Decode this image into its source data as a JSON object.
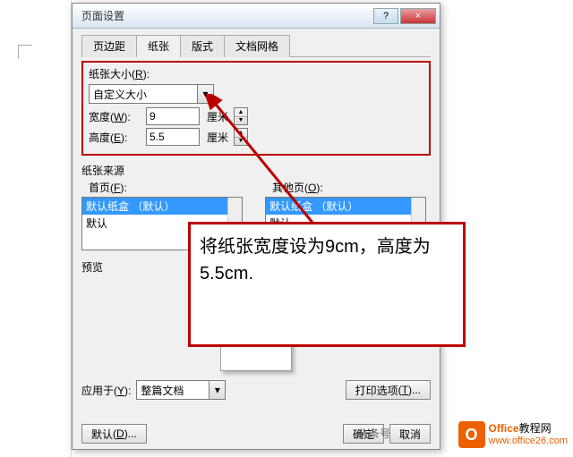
{
  "dialog": {
    "title": "页面设置",
    "help_btn": "?",
    "close_btn": "×"
  },
  "tabs": {
    "margins": "页边距",
    "paper": "纸张",
    "layout": "版式",
    "grid": "文档网格"
  },
  "paper_size": {
    "group_label": "纸张大小",
    "group_key": "R",
    "selected": "自定义大小",
    "width_label": "宽度",
    "width_key": "W",
    "width_value": "9",
    "width_unit": "厘米",
    "height_label": "高度",
    "height_key": "E",
    "height_value": "5.5",
    "height_unit": "厘米"
  },
  "paper_source": {
    "section": "纸张来源",
    "first_page_label": "首页",
    "first_key": "F",
    "other_page_label": "其他页",
    "other_key": "O",
    "items": {
      "default_tray": "默认纸盒 （默认）",
      "default": "默认"
    }
  },
  "preview": {
    "label": "预览"
  },
  "apply": {
    "label": "应用于",
    "key": "Y",
    "value": "整篇文档"
  },
  "buttons": {
    "print_options": "打印选项",
    "print_key": "T",
    "default": "默认",
    "default_key": "D",
    "ok": "确定",
    "cancel": "取消"
  },
  "annotation": "将纸张宽度设为9cm，高度为5.5cm.",
  "watermark": {
    "icon_letter": "O",
    "brand": "Office",
    "brand_suffix": "教程网",
    "url": "www.office26.com"
  },
  "headline": "头条号"
}
